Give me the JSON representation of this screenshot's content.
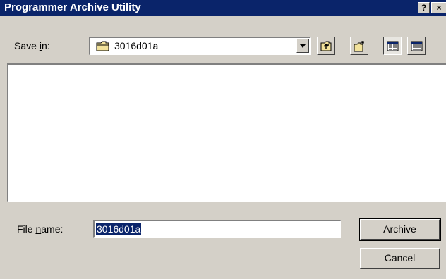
{
  "window": {
    "title": "Programmer Archive Utility",
    "help_glyph": "?",
    "close_glyph": "×"
  },
  "save_in": {
    "label_pre": "Save ",
    "label_underline": "i",
    "label_post": "n:",
    "folder_icon": "folder-icon",
    "value": "3016d01a"
  },
  "toolbar": {
    "buttons": [
      {
        "name": "up-one-level",
        "icon": "folder-up-icon"
      },
      {
        "name": "create-new-folder",
        "icon": "new-folder-icon"
      },
      {
        "name": "list-view",
        "icon": "list-view-icon",
        "pressed": true
      },
      {
        "name": "details-view",
        "icon": "details-view-icon"
      }
    ]
  },
  "file_list": {
    "items": []
  },
  "file_name": {
    "label_pre": "File ",
    "label_underline": "n",
    "label_post": "ame:",
    "value": "3016d01a"
  },
  "buttons": {
    "archive": "Archive",
    "cancel": "Cancel"
  },
  "colors": {
    "titlebar": "#0a246a",
    "face": "#d4d0c8",
    "selection": "#0a246a"
  }
}
